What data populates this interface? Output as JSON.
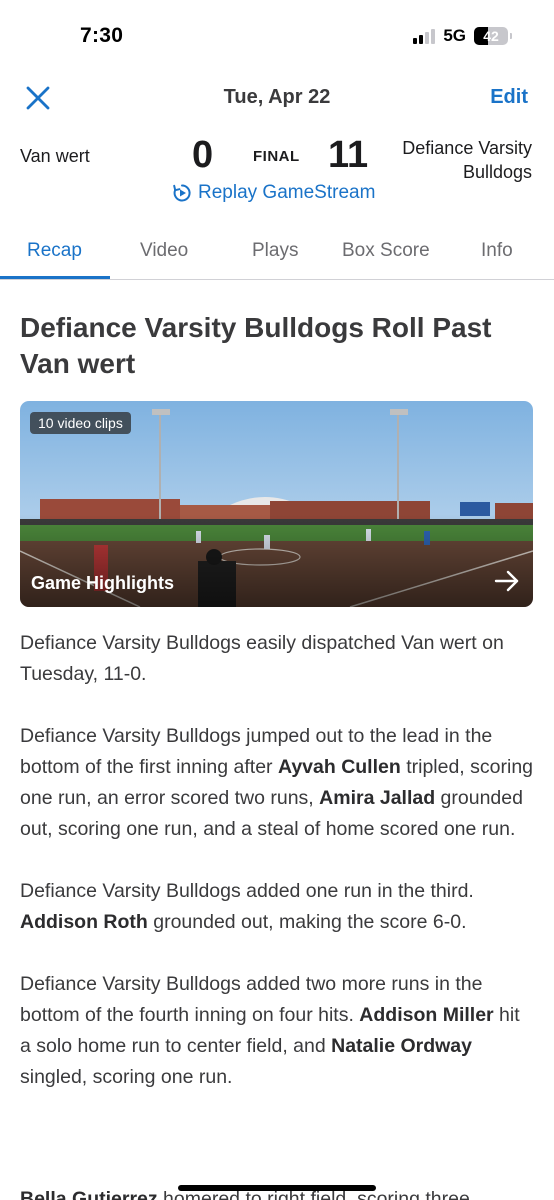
{
  "status_bar": {
    "time": "7:30",
    "network": "5G",
    "battery": "42",
    "battery_level": 0.42
  },
  "nav": {
    "date": "Tue, Apr 22",
    "edit_label": "Edit",
    "close_icon": "close-x-icon"
  },
  "game": {
    "away_team": "Van wert",
    "away_score": "0",
    "status": "FINAL",
    "home_score": "11",
    "home_team": "Defiance Varsity Bulldogs",
    "replay_label": "Replay GameStream",
    "replay_icon": "replay-icon"
  },
  "tabs": [
    {
      "label": "Recap",
      "active": true
    },
    {
      "label": "Video",
      "active": false
    },
    {
      "label": "Plays",
      "active": false
    },
    {
      "label": "Box Score",
      "active": false
    },
    {
      "label": "Info",
      "active": false
    }
  ],
  "recap": {
    "headline": "Defiance Varsity Bulldogs Roll Past Van wert",
    "video": {
      "clips_badge": "10 video clips",
      "title": "Game Highlights",
      "arrow_icon": "arrow-right-icon"
    },
    "paragraphs": [
      [
        {
          "text": "Defiance Varsity Bulldogs easily dispatched Van wert on Tuesday, 11-0.",
          "bold": false
        }
      ],
      [
        {
          "text": "Defiance Varsity Bulldogs jumped out to the lead in the bottom of the first inning after ",
          "bold": false
        },
        {
          "text": "Ayvah Cullen",
          "bold": true
        },
        {
          "text": " tripled, scoring one run, an error scored two runs, ",
          "bold": false
        },
        {
          "text": "Amira Jallad",
          "bold": true
        },
        {
          "text": " grounded out, scoring one run, and a steal of home scored one run.",
          "bold": false
        }
      ],
      [
        {
          "text": "Defiance Varsity Bulldogs added one run in the third. ",
          "bold": false
        },
        {
          "text": "Addison Roth",
          "bold": true
        },
        {
          "text": " grounded out, making the score 6-0.",
          "bold": false
        }
      ],
      [
        {
          "text": "Defiance Varsity Bulldogs added two more runs in the bottom of the fourth inning on four hits. ",
          "bold": false
        },
        {
          "text": "Addison Miller",
          "bold": true
        },
        {
          "text": " hit a solo home run to center field, and ",
          "bold": false
        },
        {
          "text": "Natalie Ordway",
          "bold": true
        },
        {
          "text": " singled, scoring one run.",
          "bold": false
        }
      ]
    ],
    "clipped_line": [
      {
        "text": "Bella Gutierrez",
        "bold": true
      },
      {
        "text": " homered to right field, scoring three",
        "bold": false
      }
    ]
  },
  "colors": {
    "accent": "#1a73c8",
    "text": "#3a3a3c"
  }
}
